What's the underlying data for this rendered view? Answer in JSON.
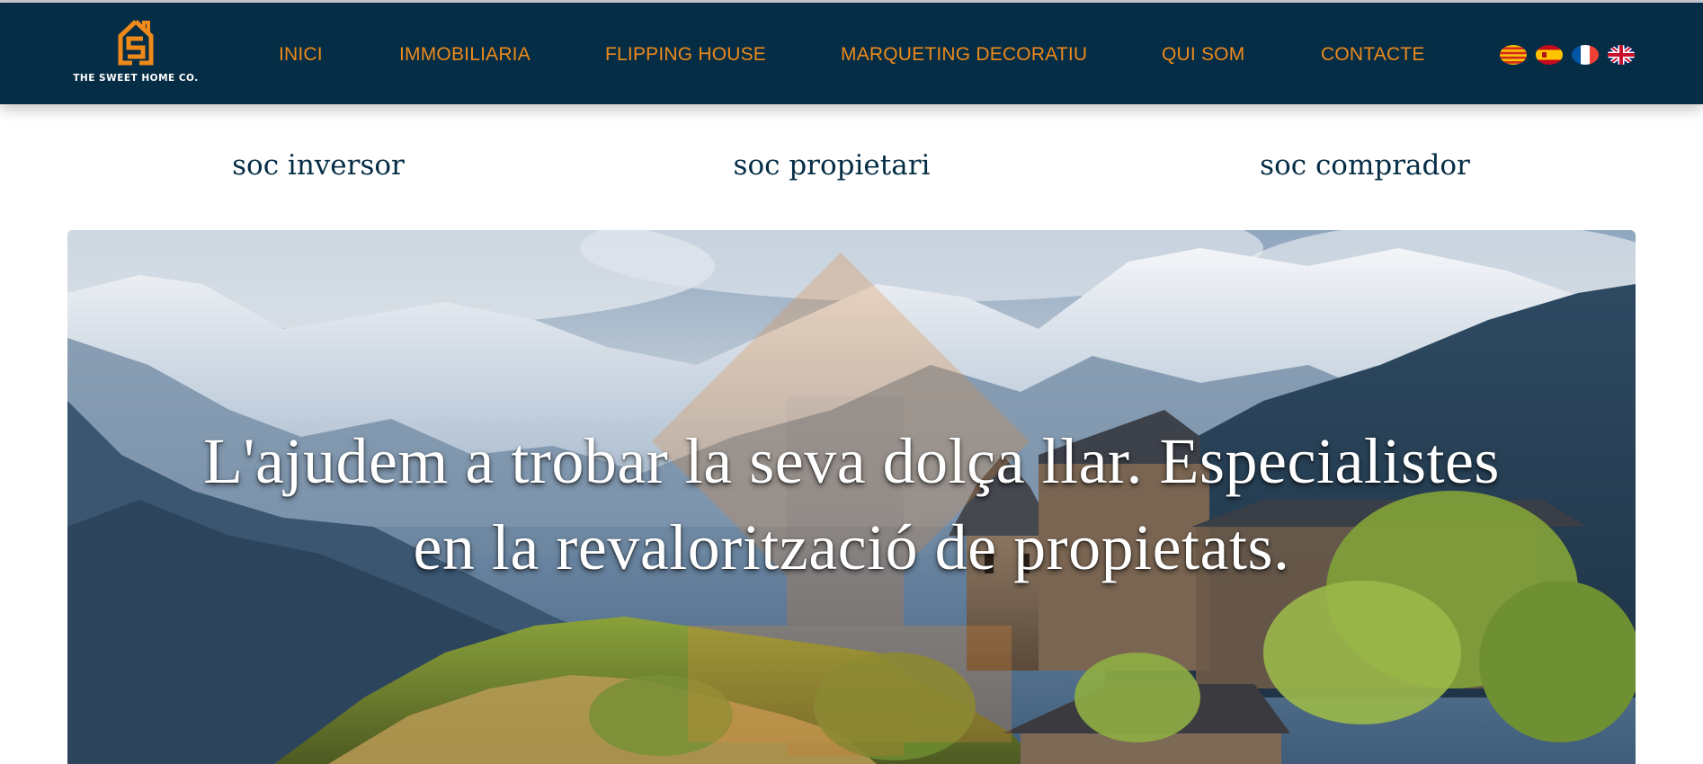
{
  "brand": {
    "name": "THE SWEET HOME CO.",
    "logo_icon": "house-s-logo-icon",
    "accent_color": "#ee8a1a",
    "nav_bg_color": "#052d45"
  },
  "nav": {
    "items": [
      {
        "label": "INICI"
      },
      {
        "label": "IMMOBILIARIA"
      },
      {
        "label": "FLIPPING HOUSE"
      },
      {
        "label": "MARQUETING DECORATIU"
      },
      {
        "label": "QUI SOM"
      },
      {
        "label": "CONTACTE"
      }
    ]
  },
  "languages": [
    {
      "icon": "catalan-flag-icon"
    },
    {
      "icon": "spanish-flag-icon"
    },
    {
      "icon": "french-flag-icon"
    },
    {
      "icon": "uk-flag-icon"
    }
  ],
  "roles": [
    {
      "label": "soc inversor"
    },
    {
      "label": "soc propietari"
    },
    {
      "label": "soc comprador"
    }
  ],
  "hero": {
    "line1": "L'ajudem a trobar la seva dolça llar. Especialistes",
    "line2": "en la revalorització de propietats.",
    "image": "mountain-village-photo"
  }
}
